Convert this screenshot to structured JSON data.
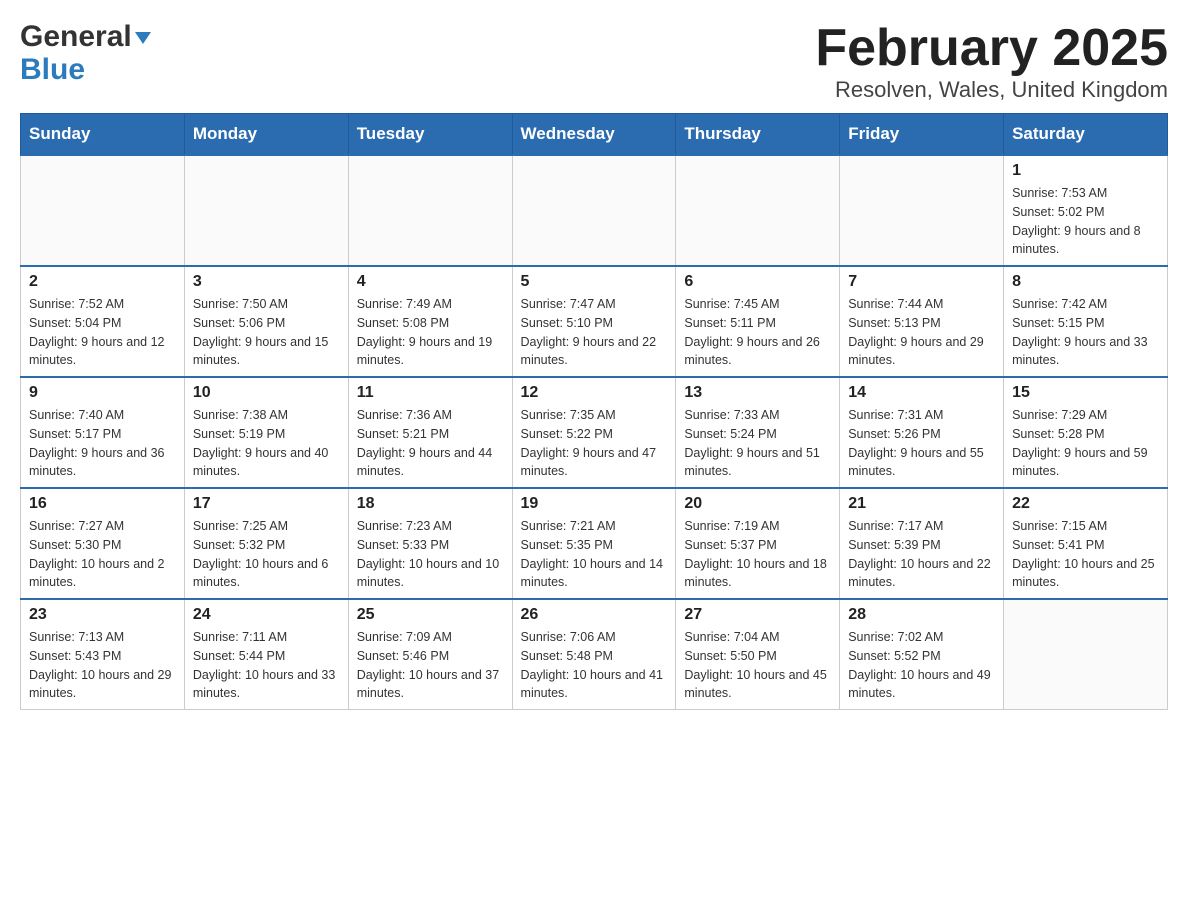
{
  "header": {
    "logo_general": "General",
    "logo_blue": "Blue",
    "title": "February 2025",
    "subtitle": "Resolven, Wales, United Kingdom"
  },
  "calendar": {
    "days_of_week": [
      "Sunday",
      "Monday",
      "Tuesday",
      "Wednesday",
      "Thursday",
      "Friday",
      "Saturday"
    ],
    "weeks": [
      [
        {
          "day": "",
          "info": ""
        },
        {
          "day": "",
          "info": ""
        },
        {
          "day": "",
          "info": ""
        },
        {
          "day": "",
          "info": ""
        },
        {
          "day": "",
          "info": ""
        },
        {
          "day": "",
          "info": ""
        },
        {
          "day": "1",
          "info": "Sunrise: 7:53 AM\nSunset: 5:02 PM\nDaylight: 9 hours and 8 minutes."
        }
      ],
      [
        {
          "day": "2",
          "info": "Sunrise: 7:52 AM\nSunset: 5:04 PM\nDaylight: 9 hours and 12 minutes."
        },
        {
          "day": "3",
          "info": "Sunrise: 7:50 AM\nSunset: 5:06 PM\nDaylight: 9 hours and 15 minutes."
        },
        {
          "day": "4",
          "info": "Sunrise: 7:49 AM\nSunset: 5:08 PM\nDaylight: 9 hours and 19 minutes."
        },
        {
          "day": "5",
          "info": "Sunrise: 7:47 AM\nSunset: 5:10 PM\nDaylight: 9 hours and 22 minutes."
        },
        {
          "day": "6",
          "info": "Sunrise: 7:45 AM\nSunset: 5:11 PM\nDaylight: 9 hours and 26 minutes."
        },
        {
          "day": "7",
          "info": "Sunrise: 7:44 AM\nSunset: 5:13 PM\nDaylight: 9 hours and 29 minutes."
        },
        {
          "day": "8",
          "info": "Sunrise: 7:42 AM\nSunset: 5:15 PM\nDaylight: 9 hours and 33 minutes."
        }
      ],
      [
        {
          "day": "9",
          "info": "Sunrise: 7:40 AM\nSunset: 5:17 PM\nDaylight: 9 hours and 36 minutes."
        },
        {
          "day": "10",
          "info": "Sunrise: 7:38 AM\nSunset: 5:19 PM\nDaylight: 9 hours and 40 minutes."
        },
        {
          "day": "11",
          "info": "Sunrise: 7:36 AM\nSunset: 5:21 PM\nDaylight: 9 hours and 44 minutes."
        },
        {
          "day": "12",
          "info": "Sunrise: 7:35 AM\nSunset: 5:22 PM\nDaylight: 9 hours and 47 minutes."
        },
        {
          "day": "13",
          "info": "Sunrise: 7:33 AM\nSunset: 5:24 PM\nDaylight: 9 hours and 51 minutes."
        },
        {
          "day": "14",
          "info": "Sunrise: 7:31 AM\nSunset: 5:26 PM\nDaylight: 9 hours and 55 minutes."
        },
        {
          "day": "15",
          "info": "Sunrise: 7:29 AM\nSunset: 5:28 PM\nDaylight: 9 hours and 59 minutes."
        }
      ],
      [
        {
          "day": "16",
          "info": "Sunrise: 7:27 AM\nSunset: 5:30 PM\nDaylight: 10 hours and 2 minutes."
        },
        {
          "day": "17",
          "info": "Sunrise: 7:25 AM\nSunset: 5:32 PM\nDaylight: 10 hours and 6 minutes."
        },
        {
          "day": "18",
          "info": "Sunrise: 7:23 AM\nSunset: 5:33 PM\nDaylight: 10 hours and 10 minutes."
        },
        {
          "day": "19",
          "info": "Sunrise: 7:21 AM\nSunset: 5:35 PM\nDaylight: 10 hours and 14 minutes."
        },
        {
          "day": "20",
          "info": "Sunrise: 7:19 AM\nSunset: 5:37 PM\nDaylight: 10 hours and 18 minutes."
        },
        {
          "day": "21",
          "info": "Sunrise: 7:17 AM\nSunset: 5:39 PM\nDaylight: 10 hours and 22 minutes."
        },
        {
          "day": "22",
          "info": "Sunrise: 7:15 AM\nSunset: 5:41 PM\nDaylight: 10 hours and 25 minutes."
        }
      ],
      [
        {
          "day": "23",
          "info": "Sunrise: 7:13 AM\nSunset: 5:43 PM\nDaylight: 10 hours and 29 minutes."
        },
        {
          "day": "24",
          "info": "Sunrise: 7:11 AM\nSunset: 5:44 PM\nDaylight: 10 hours and 33 minutes."
        },
        {
          "day": "25",
          "info": "Sunrise: 7:09 AM\nSunset: 5:46 PM\nDaylight: 10 hours and 37 minutes."
        },
        {
          "day": "26",
          "info": "Sunrise: 7:06 AM\nSunset: 5:48 PM\nDaylight: 10 hours and 41 minutes."
        },
        {
          "day": "27",
          "info": "Sunrise: 7:04 AM\nSunset: 5:50 PM\nDaylight: 10 hours and 45 minutes."
        },
        {
          "day": "28",
          "info": "Sunrise: 7:02 AM\nSunset: 5:52 PM\nDaylight: 10 hours and 49 minutes."
        },
        {
          "day": "",
          "info": ""
        }
      ]
    ]
  }
}
